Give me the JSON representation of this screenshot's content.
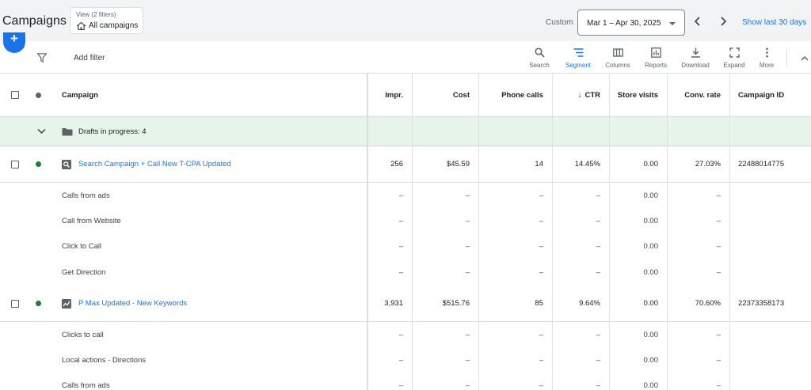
{
  "header": {
    "title": "Campaigns",
    "view_caption": "View (2 filters)",
    "view_name": "All campaigns",
    "custom_label": "Custom",
    "date_range": "Mar 1 – Apr 30, 2025",
    "show_last": "Show last 30 days"
  },
  "fab": {
    "label": "+"
  },
  "toolbar": {
    "add_filter": "Add filter",
    "tools": {
      "search": "Search",
      "segment": "Segment",
      "columns": "Columns",
      "reports": "Reports",
      "download": "Download",
      "expand": "Expand",
      "more": "More"
    }
  },
  "table": {
    "columns": {
      "campaign": "Campaign",
      "impr": "Impr.",
      "cost": "Cost",
      "phone_calls": "Phone calls",
      "ctr": "CTR",
      "store_visits": "Store visits",
      "conv_rate": "Conv. rate",
      "campaign_id": "Campaign ID"
    },
    "sort_arrow": "↓",
    "drafts": "Drafts in progress: 4",
    "rows": [
      {
        "kind": "campaign",
        "name": "Search Campaign + Call New T-CPA Updated",
        "icon": "search-campaign-icon",
        "impr": "256",
        "cost": "$45.59",
        "phone_calls": "14",
        "ctr": "14.45%",
        "store_visits": "0.00",
        "conv_rate": "27.03%",
        "campaign_id": "22488014775"
      },
      {
        "kind": "segment",
        "name": "Calls from ads",
        "impr": "–",
        "cost": "–",
        "phone_calls": "–",
        "ctr": "–",
        "store_visits": "0.00",
        "conv_rate": "–",
        "campaign_id": ""
      },
      {
        "kind": "segment",
        "name": "Call from Website",
        "impr": "–",
        "cost": "–",
        "phone_calls": "–",
        "ctr": "–",
        "store_visits": "0.00",
        "conv_rate": "–",
        "campaign_id": ""
      },
      {
        "kind": "segment",
        "name": "Click to Call",
        "impr": "–",
        "cost": "–",
        "phone_calls": "–",
        "ctr": "–",
        "store_visits": "0.00",
        "conv_rate": "–",
        "campaign_id": ""
      },
      {
        "kind": "segment",
        "name": "Get Direction",
        "impr": "–",
        "cost": "–",
        "phone_calls": "–",
        "ctr": "–",
        "store_visits": "0.00",
        "conv_rate": "–",
        "campaign_id": ""
      },
      {
        "kind": "campaign",
        "name": "P Max Updated - New Keywords",
        "icon": "pmax-campaign-icon",
        "impr": "3,931",
        "cost": "$515.76",
        "phone_calls": "85",
        "ctr": "9.64%",
        "store_visits": "0.00",
        "conv_rate": "70.60%",
        "campaign_id": "22373358173"
      },
      {
        "kind": "segment",
        "name": "Clicks to call",
        "impr": "–",
        "cost": "–",
        "phone_calls": "–",
        "ctr": "–",
        "store_visits": "0.00",
        "conv_rate": "–",
        "campaign_id": ""
      },
      {
        "kind": "segment",
        "name": "Local actions - Directions",
        "impr": "–",
        "cost": "–",
        "phone_calls": "–",
        "ctr": "–",
        "store_visits": "0.00",
        "conv_rate": "–",
        "campaign_id": ""
      },
      {
        "kind": "segment",
        "name": "Calls from ads",
        "impr": "–",
        "cost": "–",
        "phone_calls": "–",
        "ctr": "–",
        "store_visits": "0.00",
        "conv_rate": "–",
        "campaign_id": ""
      }
    ]
  },
  "colors": {
    "accent": "#1a73e8",
    "status_enabled": "#188038",
    "status_header": "#5f6368",
    "drafts_bg": "#e6f4ea"
  }
}
